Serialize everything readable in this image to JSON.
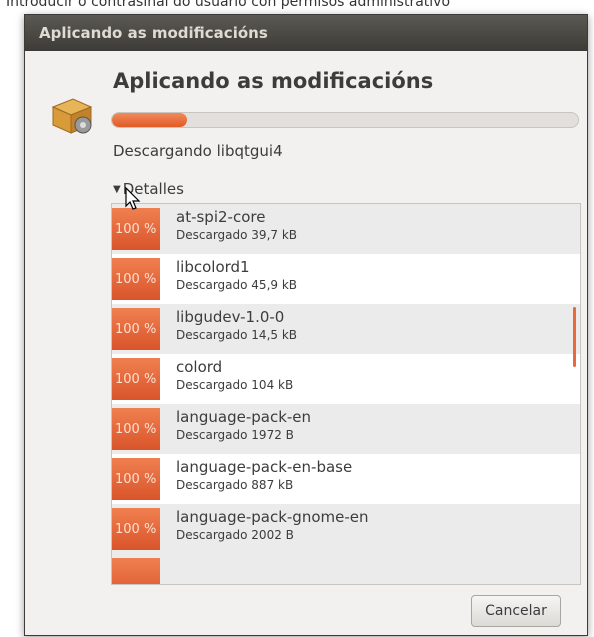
{
  "background_text": "Introducir o contrasinal do usuario con permisos administrativo",
  "window": {
    "title": "Aplicando as modificacións",
    "heading": "Aplicando as modificacións",
    "progress": 0.16,
    "status": "Descargando libqtgui4",
    "details_label": "Detalles",
    "cancel_label": "Cancelar",
    "accent_color": "#e05a26"
  },
  "packages": [
    {
      "percent": "100 %",
      "name": "at-spi2-core",
      "detail": "Descargado 39,7 kB"
    },
    {
      "percent": "100 %",
      "name": "libcolord1",
      "detail": "Descargado 45,9 kB"
    },
    {
      "percent": "100 %",
      "name": "libgudev-1.0-0",
      "detail": "Descargado 14,5 kB"
    },
    {
      "percent": "100 %",
      "name": "colord",
      "detail": "Descargado 104 kB"
    },
    {
      "percent": "100 %",
      "name": "language-pack-en",
      "detail": "Descargado 1972 B"
    },
    {
      "percent": "100 %",
      "name": "language-pack-en-base",
      "detail": "Descargado 887 kB"
    },
    {
      "percent": "100 %",
      "name": "language-pack-gnome-en",
      "detail": "Descargado 2002 B"
    }
  ],
  "icons": {
    "app": "package-box-icon",
    "cursor": "mouse-pointer-icon",
    "toggle": "expander-triangle-icon"
  }
}
